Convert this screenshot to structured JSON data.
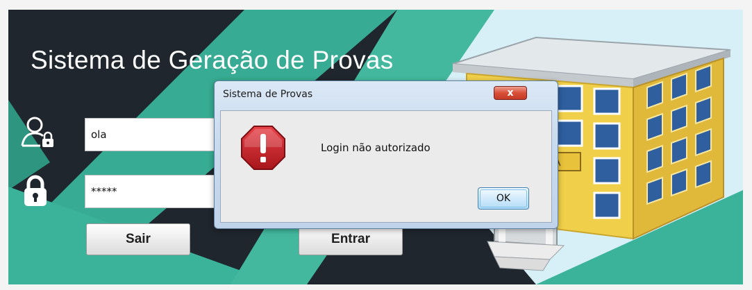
{
  "app": {
    "title": "Sistema de Geração de Provas",
    "username_value": "ola",
    "password_value": "*****",
    "exit_button_label": "Sair",
    "login_button_label": "Entrar",
    "building_sign": "LA"
  },
  "dialog": {
    "title": "Sistema de Provas",
    "close_glyph": "x",
    "message": "Login não autorizado",
    "ok_label": "OK"
  },
  "icons": {
    "user": "user-lock-icon",
    "password": "padlock-icon",
    "error": "error-stop-icon",
    "building": "building-illustration"
  },
  "colors": {
    "dark_background": "#1f262d",
    "teal_accent": "#3bb39a",
    "error_red": "#c8262a",
    "building_yellow": "#f0d04a"
  }
}
